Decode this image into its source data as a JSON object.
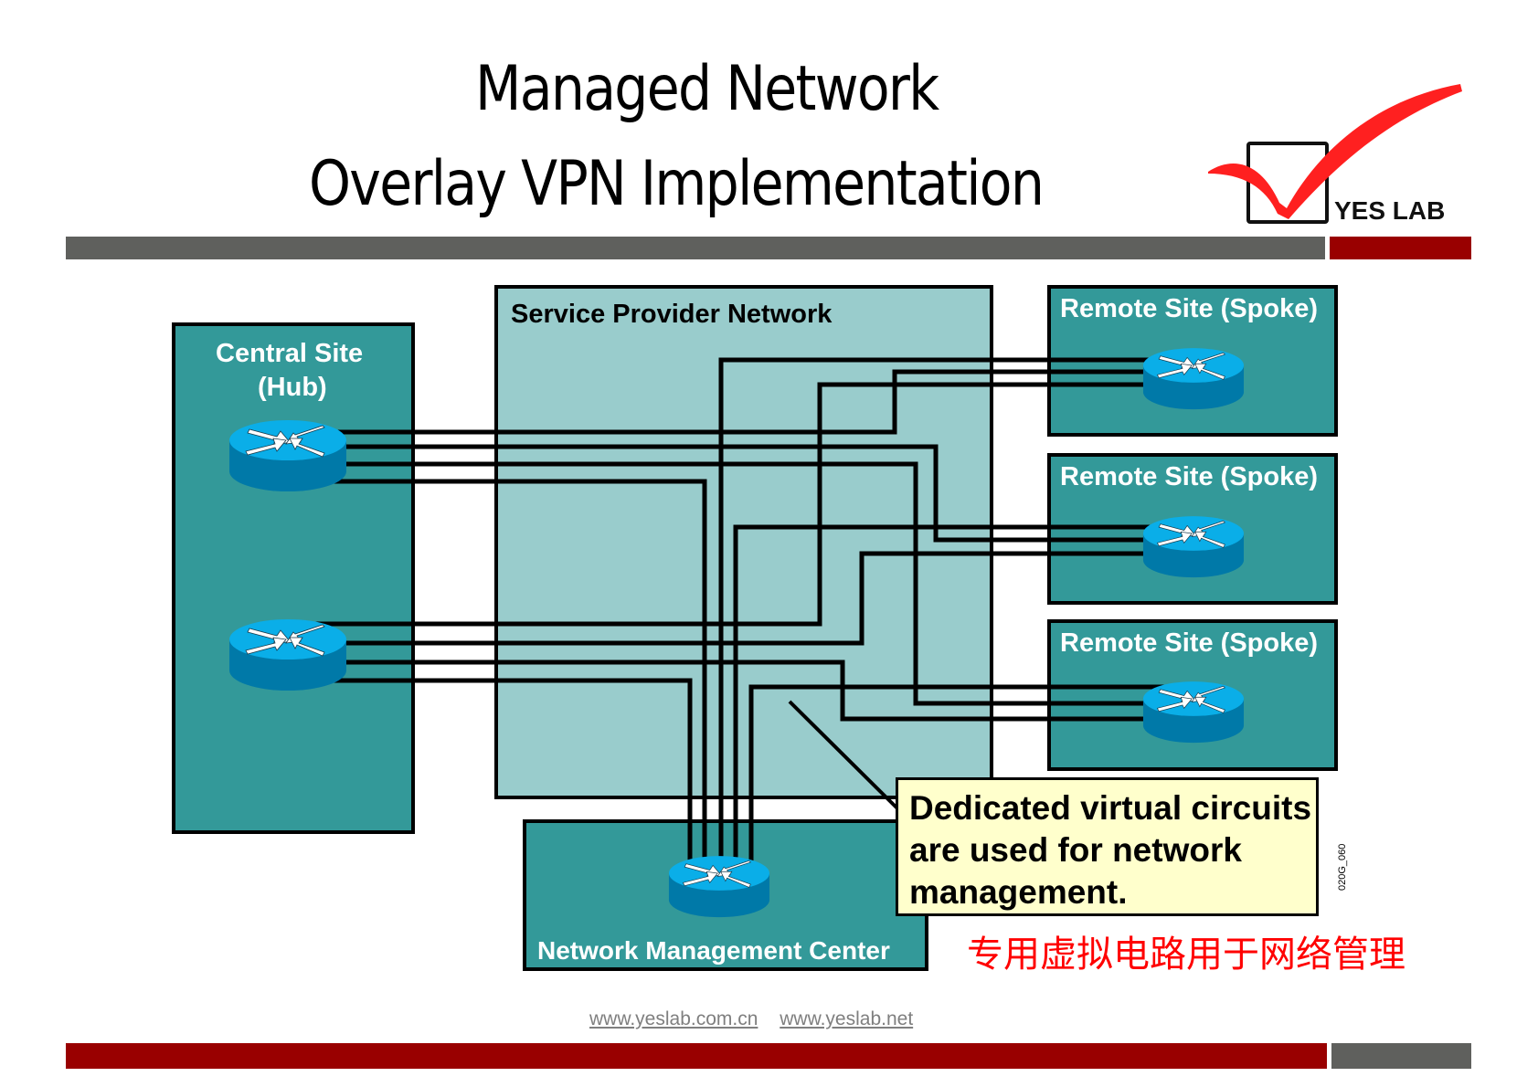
{
  "header": {
    "title_line1": "Managed Network",
    "title_line2": "Overlay VPN Implementation",
    "logo_text": "YES LAB",
    "logo_icon": "checkmark-box-icon"
  },
  "colors": {
    "bar_gray": "#5f605d",
    "bar_red": "#990000",
    "site_teal": "#339999",
    "provider_light": "#99cccc",
    "callout_bg": "#ffffcc",
    "router_top": "#0aaee8",
    "router_side": "#0079a8",
    "check_red": "#ff2020",
    "translation_red": "#ff0000"
  },
  "diagram": {
    "central_site": {
      "label_line1": "Central Site",
      "label_line2": "(Hub)",
      "routers": 2
    },
    "service_provider": {
      "label": "Service Provider Network"
    },
    "remote_sites": [
      {
        "label": "Remote Site (Spoke)"
      },
      {
        "label": "Remote Site (Spoke)"
      },
      {
        "label": "Remote Site (Spoke)"
      }
    ],
    "nmc": {
      "label": "Network Management Center"
    },
    "callout": {
      "line1": "Dedicated virtual circuits",
      "line2": "are used for network",
      "line3": "management."
    },
    "translation": "专用虚拟电路用于网络管理",
    "figure_code": "020G_060"
  },
  "footer": {
    "links": [
      "www.yeslab.com.cn",
      "www.yeslab.net"
    ]
  }
}
